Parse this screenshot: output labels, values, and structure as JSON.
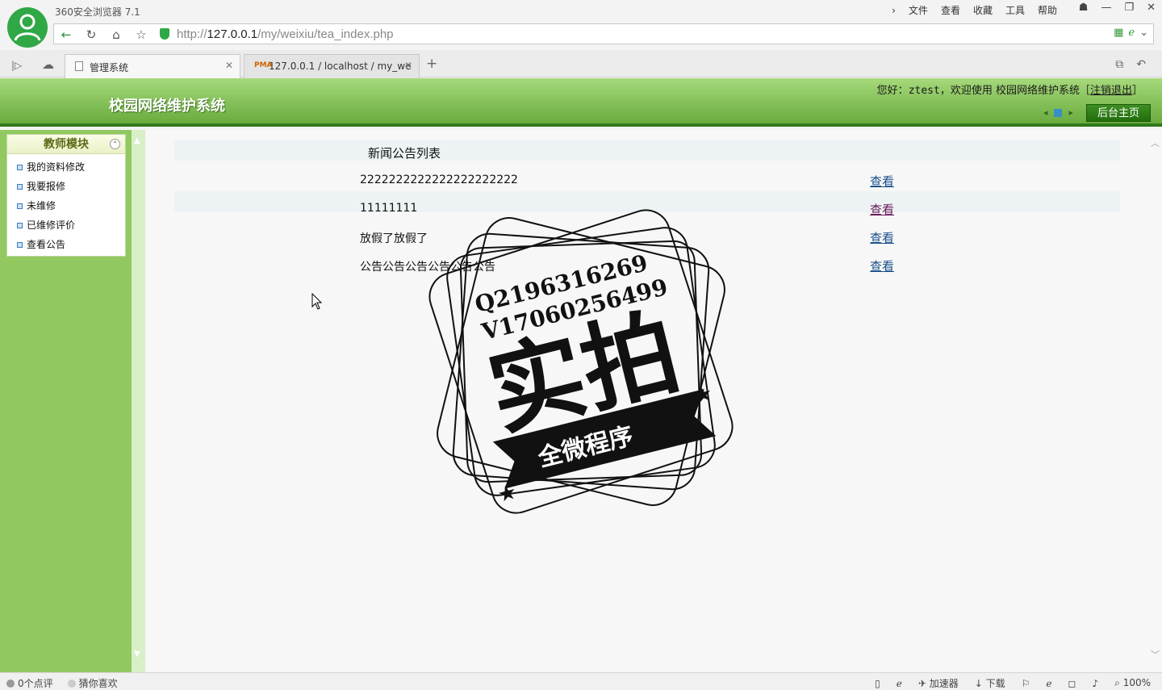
{
  "browser": {
    "app_title": "360安全浏览器 7.1",
    "menu": [
      "文件",
      "查看",
      "收藏",
      "工具",
      "帮助"
    ],
    "url_prefix": "http://",
    "url_host": "127.0.0.1",
    "url_path": "/my/weixiu/tea_index.php",
    "tabs": [
      {
        "label": "管理系统",
        "active": true
      },
      {
        "label": "127.0.0.1 / localhost / my_we",
        "active": false
      }
    ]
  },
  "header": {
    "site_title": "校园网络维护系统",
    "welcome_prefix": "您好：",
    "user": "ztest",
    "welcome_suffix": "，欢迎使用 校园网络维护系统［",
    "logout": "注销退出",
    "welcome_end": "］",
    "home_button": "后台主页"
  },
  "sidebar": {
    "panel_title": "教师模块",
    "items": [
      {
        "label": "我的资料修改"
      },
      {
        "label": "我要报修"
      },
      {
        "label": "未维修"
      },
      {
        "label": "已维修评价"
      },
      {
        "label": "查看公告"
      }
    ]
  },
  "main": {
    "list_title": "新闻公告列表",
    "rows": [
      {
        "title": "2222222222222222222222",
        "action": "查看"
      },
      {
        "title": "11111111",
        "action": "查看"
      },
      {
        "title": "放假了放假了",
        "action": "查看"
      },
      {
        "title": "公告公告公告公告公告公告",
        "action": "查看"
      }
    ]
  },
  "watermark": {
    "line1": "Q2196316269",
    "line2": "V17060256499",
    "big": "实拍",
    "banner": "全微程序"
  },
  "statusbar": {
    "comments": "0个点评",
    "recommend": "猜你喜欢",
    "accelerator": "加速器",
    "download": "下载",
    "zoom": "100%"
  }
}
